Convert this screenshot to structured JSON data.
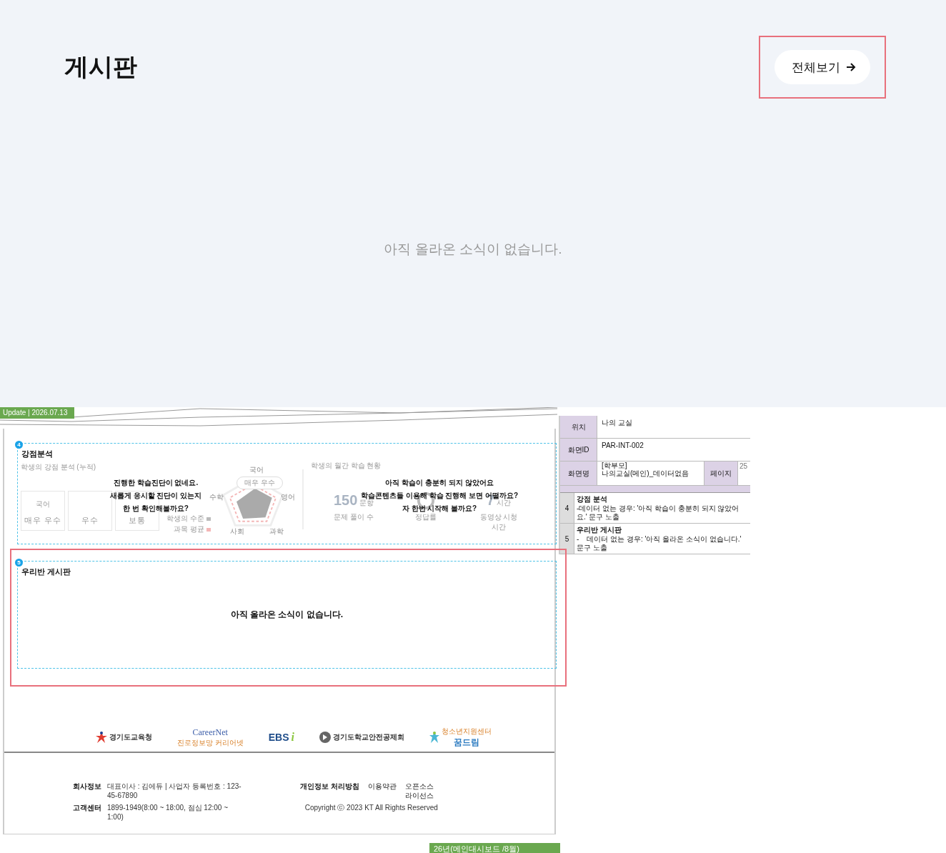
{
  "board": {
    "title": "게시판",
    "view_all_button": "전체보기",
    "empty_message": "아직 올라온 소식이 없습니다."
  },
  "spec_page": {
    "update_tag": "Update | 2026.07.13",
    "strength_section": {
      "number": "4",
      "title": "강점분석",
      "left": {
        "subtitle": "학생의 강점 분석 (누적)",
        "cards": [
          {
            "label": "국어",
            "value": "매우 우수"
          },
          {
            "value": "우수"
          },
          {
            "value": "보통"
          }
        ],
        "radar_labels": [
          "국어",
          "영어",
          "과학",
          "사회",
          "수학"
        ],
        "radar_badge": "매우 우수",
        "legend": [
          {
            "label": "학생의 수준",
            "color": "#bbbbbb"
          },
          {
            "label": "과목 평균",
            "color": "#f4b6b6"
          }
        ]
      },
      "right": {
        "subtitle": "학생의 월간 학습 현황",
        "stats": [
          {
            "kind": "number",
            "value": "150",
            "unit": "문항",
            "label": "문제 풀이 수"
          },
          {
            "kind": "ring",
            "label": "정답률"
          },
          {
            "kind": "number",
            "value": "7",
            "unit": "시간",
            "label": "동영상 시청 시간"
          }
        ]
      },
      "messages": [
        [
          "진행한 학습진단이 없네요.",
          "새롭게 응시할 진단이 있는지",
          "한 번 확인해볼까요?"
        ],
        [
          "아직 학습이 충분히 되지 않았어요",
          "학습콘텐츠들 이용해 학습 진행해 보면 어떨까요?",
          "자 한번 시작해 볼까요?"
        ]
      ]
    },
    "board_section": {
      "number": "5",
      "title": "우리반 게시판",
      "empty_message": "아직 올라온 소식이 없습니다."
    },
    "partners": [
      {
        "kind": "star",
        "name": "경기도교육청"
      },
      {
        "kind": "career",
        "name": "CareerNet",
        "sub": "진로정보망 커리어넷"
      },
      {
        "kind": "ebs",
        "name": "EBS",
        "mark": "i"
      },
      {
        "kind": "circle",
        "name": "경기도학교안전공제회"
      },
      {
        "kind": "dream",
        "name": "꿈드림",
        "sub": "청소년지원센터"
      }
    ],
    "footer": {
      "info": [
        {
          "label": "회사정보",
          "text": "대표이사 : 김에듀  |  사업자 등록번호 : 123-45-67890"
        },
        {
          "label": "고객센터",
          "text": "1899-1949(8:00 ~ 18:00, 점심 12:00 ~ 1:00)"
        }
      ],
      "links": [
        {
          "text": "개인정보 처리방침",
          "bold": true
        },
        {
          "text": "이용약관",
          "bold": false
        },
        {
          "text": "오픈소스 라이선스",
          "bold": false
        }
      ],
      "copyright": "Copyright ⓒ 2023 KT All Rights Reserved"
    },
    "page_tag": "26년(메인대시보드 /8월)"
  },
  "spec_table": {
    "location_label": "위치",
    "location": "나의 교실",
    "screen_id_label": "화면ID",
    "screen_id": "PAR-INT-002",
    "screen_name_label": "화면명",
    "screen_name": "[학부모]\n나의교실(메인)_데이터없음",
    "page_label": "페이지",
    "page": "25",
    "descriptions": [
      {
        "number": "4",
        "title": "강점 분석",
        "text": "-데이터 없는 경우: '아직 학습이 충분히 되지 않았어요.' 문구 노출"
      },
      {
        "number": "5",
        "title": "우리반 게시판",
        "text": "-    데이터 없는 경우: '아직 올라온 소식이 없습니다.' 문구 노출"
      }
    ]
  }
}
